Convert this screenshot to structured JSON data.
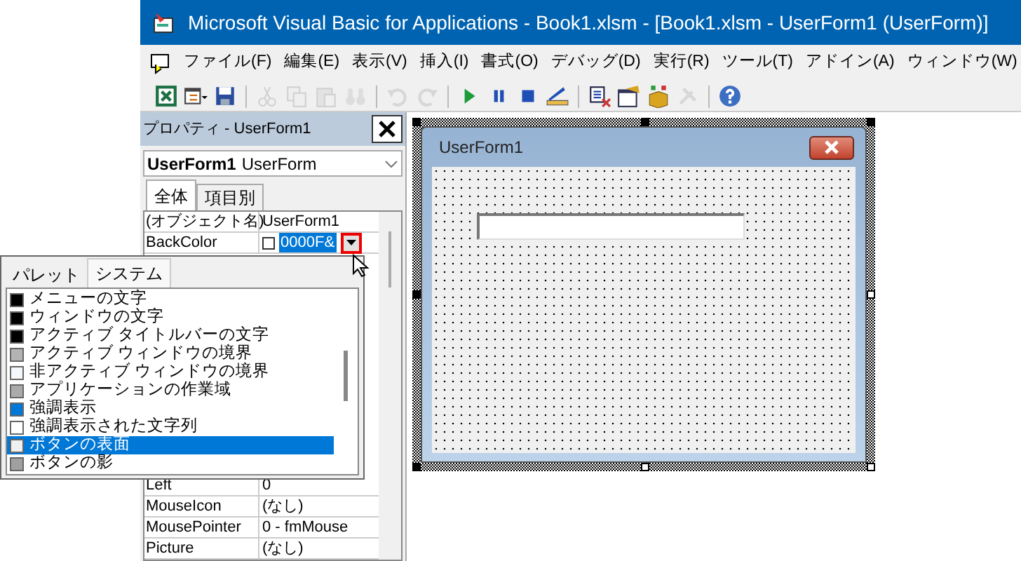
{
  "window": {
    "title": "Microsoft Visual Basic for Applications - Book1.xlsm - [Book1.xlsm - UserForm1 (UserForm)]"
  },
  "menu": [
    "ファイル(F)",
    "編集(E)",
    "表示(V)",
    "挿入(I)",
    "書式(O)",
    "デバッグ(D)",
    "実行(R)",
    "ツール(T)",
    "アドイン(A)",
    "ウィンドウ(W)"
  ],
  "toolbar": [
    {
      "kind": "button",
      "disabled": false
    },
    {
      "kind": "button",
      "disabled": false
    },
    {
      "kind": "button",
      "disabled": false
    },
    {
      "kind": "separator"
    },
    {
      "kind": "button",
      "disabled": true
    },
    {
      "kind": "button",
      "disabled": true
    },
    {
      "kind": "button",
      "disabled": true
    },
    {
      "kind": "button",
      "disabled": true
    },
    {
      "kind": "separator"
    },
    {
      "kind": "button",
      "disabled": true
    },
    {
      "kind": "button",
      "disabled": true
    },
    {
      "kind": "separator"
    },
    {
      "kind": "button",
      "disabled": false
    },
    {
      "kind": "button",
      "disabled": false
    },
    {
      "kind": "button",
      "disabled": false
    },
    {
      "kind": "button",
      "disabled": false
    },
    {
      "kind": "separator"
    },
    {
      "kind": "button",
      "disabled": false
    },
    {
      "kind": "button",
      "disabled": false
    },
    {
      "kind": "button",
      "disabled": false
    },
    {
      "kind": "button",
      "disabled": true
    },
    {
      "kind": "separator"
    },
    {
      "kind": "button",
      "disabled": false
    }
  ],
  "properties": {
    "title": "プロパティ - UserForm1",
    "object": {
      "name": "UserForm1",
      "type": "UserForm"
    },
    "tabs": [
      {
        "label": "全体",
        "selected": true
      },
      {
        "label": "項目別",
        "selected": false
      }
    ],
    "rows_top": [
      {
        "name": "(オブジェクト名)",
        "value": "UserForm1",
        "selected": false
      },
      {
        "name": "BackColor",
        "value": "0000F&",
        "selected": true
      }
    ],
    "rows_bottom": [
      {
        "name": "Left",
        "value": "0"
      },
      {
        "name": "MouseIcon",
        "value": "(なし)"
      },
      {
        "name": "MousePointer",
        "value": "0 - fmMouse"
      },
      {
        "name": "Picture",
        "value": "(なし)"
      }
    ]
  },
  "color_popup": {
    "tabs": [
      {
        "label": "パレット",
        "selected": false
      },
      {
        "label": "システム",
        "selected": true
      }
    ],
    "items": [
      {
        "label": "メニューの文字",
        "color": "#000000",
        "selected": false
      },
      {
        "label": "ウィンドウの文字",
        "color": "#000000",
        "selected": false
      },
      {
        "label": "アクティブ タイトルバーの文字",
        "color": "#000000",
        "selected": false
      },
      {
        "label": "アクティブ ウィンドウの境界",
        "color": "#b4b4b4",
        "selected": false
      },
      {
        "label": "非アクティブ ウィンドウの境界",
        "color": "#f4f7fc",
        "selected": false
      },
      {
        "label": "アプリケーションの作業域",
        "color": "#ababab",
        "selected": false
      },
      {
        "label": "強調表示",
        "color": "#0078d7",
        "selected": false
      },
      {
        "label": "強調表示された文字列",
        "color": "#ffffff",
        "selected": false
      },
      {
        "label": "ボタンの表面",
        "color": "#f0f0f0",
        "selected": true
      },
      {
        "label": "ボタンの影",
        "color": "#a0a0a0",
        "selected": false
      }
    ]
  },
  "designer": {
    "form": {
      "title": "UserForm1"
    }
  }
}
